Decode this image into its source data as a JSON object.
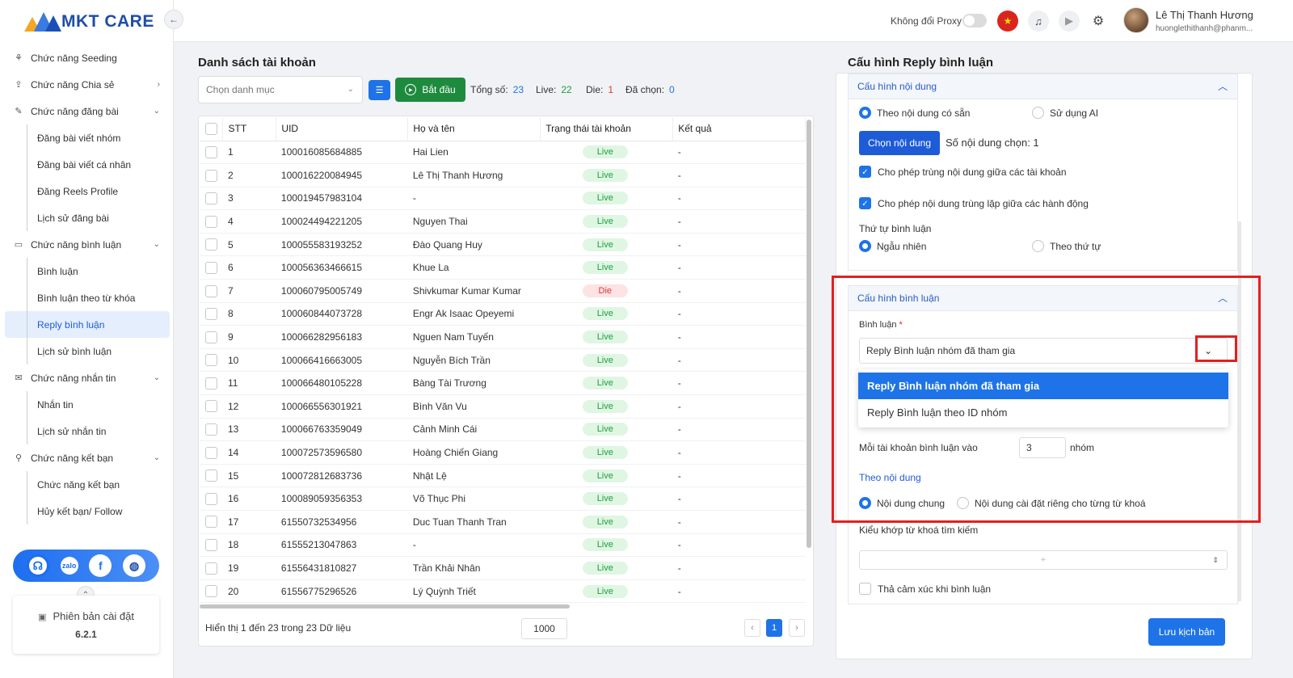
{
  "app": {
    "logo_text": "MKT CARE",
    "brand_color": "#1e4ea8"
  },
  "sidebar": {
    "groups": [
      {
        "label": "Chức năng Seeding",
        "icon": "seeding-icon",
        "chev": ""
      },
      {
        "label": "Chức năng Chia sẻ",
        "icon": "share-icon",
        "chev": "›"
      },
      {
        "label": "Chức năng đăng bài",
        "icon": "post-icon",
        "chev": "⌄"
      }
    ],
    "post_items": [
      "Đăng bài viết nhóm",
      "Đăng bài viết cá nhân",
      "Đăng Reels Profile",
      "Lịch sử đăng bài"
    ],
    "comment_group": "Chức năng bình luận",
    "comment_items": [
      "Bình luận",
      "Bình luận theo từ khóa",
      "Reply bình luận",
      "Lịch sử bình luận"
    ],
    "message_group": "Chức năng nhắn tin",
    "message_items": [
      "Nhắn tin",
      "Lịch sử nhắn tin"
    ],
    "friend_group": "Chức năng kết bạn",
    "friend_items": [
      "Chức năng kết bạn",
      "Hủy kết bạn/ Follow"
    ],
    "version_label": "Phiên bản cài đặt",
    "version_number": "6.2.1"
  },
  "topbar": {
    "proxy_label": "Không đổi Proxy",
    "user_name": "Lê Thị Thanh Hương",
    "user_email": "huonglethithanh@phanm..."
  },
  "accounts": {
    "title": "Danh sách tài khoản",
    "category_placeholder": "Chọn danh mục",
    "start_label": "Bắt đầu",
    "stats": {
      "total_label": "Tổng số:",
      "total": "23",
      "live_label": "Live:",
      "live": "22",
      "die_label": "Die:",
      "die": "1",
      "selected_label": "Đã chọn:",
      "selected": "0"
    },
    "columns": [
      "STT",
      "UID",
      "Họ và tên",
      "Trạng thái tài khoản",
      "Kết quả"
    ],
    "rows": [
      [
        "1",
        "100016085684885",
        "Hai Lien",
        "Live",
        "-"
      ],
      [
        "2",
        "100016220084945",
        "Lê Thị Thanh Hương",
        "Live",
        "-"
      ],
      [
        "3",
        "100019457983104",
        "-",
        "Live",
        "-"
      ],
      [
        "4",
        "100024494221205",
        "Nguyen Thai",
        "Live",
        "-"
      ],
      [
        "5",
        "100055583193252",
        "Đào Quang Huy",
        "Live",
        "-"
      ],
      [
        "6",
        "100056363466615",
        "Khue La",
        "Live",
        "-"
      ],
      [
        "7",
        "100060795005749",
        "Shivkumar Kumar Kumar",
        "Die",
        "-"
      ],
      [
        "8",
        "100060844073728",
        "Engr Ak Isaac Opeyemi",
        "Live",
        "-"
      ],
      [
        "9",
        "100066282956183",
        "Nguen Nam Tuyến",
        "Live",
        "-"
      ],
      [
        "10",
        "100066416663005",
        "Nguyễn Bích Trần",
        "Live",
        "-"
      ],
      [
        "11",
        "100066480105228",
        "Bàng Tài Trương",
        "Live",
        "-"
      ],
      [
        "12",
        "100066556301921",
        "Bình Văn Vu",
        "Live",
        "-"
      ],
      [
        "13",
        "100066763359049",
        "Cảnh Minh Cái",
        "Live",
        "-"
      ],
      [
        "14",
        "100072573596580",
        "Hoàng Chiến Giang",
        "Live",
        "-"
      ],
      [
        "15",
        "100072812683736",
        "Nhật Lệ",
        "Live",
        "-"
      ],
      [
        "16",
        "100089059356353",
        "Võ Thục Phi",
        "Live",
        "-"
      ],
      [
        "17",
        "61550732534956",
        "Duc Tuan Thanh Tran",
        "Live",
        "-"
      ],
      [
        "18",
        "61555213047863",
        "-",
        "Live",
        "-"
      ],
      [
        "19",
        "61556431810827",
        "Trần Khải Nhân",
        "Live",
        "-"
      ],
      [
        "20",
        "61556775296526",
        "Lý Quỳnh Triết",
        "Live",
        "-"
      ]
    ],
    "footer_text": "Hiển thị 1 đến 23 trong 23 Dữ liệu",
    "page_size": "1000",
    "current_page": "1",
    "prev": "‹",
    "next": "›"
  },
  "config": {
    "title": "Cấu hình Reply bình luận",
    "content_section": "Cấu hình nội dung",
    "radio_preset": "Theo nội dung có sẵn",
    "radio_ai": "Sử dụng AI",
    "choose_content": "Chọn nội dung",
    "content_count": "Số nội dung chọn: 1",
    "allow_dup_accounts": "Cho phép trùng nội dung giữa các tài khoản",
    "allow_dup_actions": "Cho phép nội dung trùng lặp giữa các hành động",
    "order_label": "Thứ tự bình luận",
    "order_random": "Ngẫu nhiên",
    "order_seq": "Theo thứ tự",
    "comment_section": "Cấu hình bình luận",
    "comment_label": "Bình luận",
    "required_mark": "*",
    "comment_value": "Reply Bình luận nhóm đã tham gia",
    "options": [
      "Reply Bình luận nhóm đã tham gia",
      "Reply Bình luận theo ID nhóm"
    ],
    "per_account_label": "Mỗi tài khoản bình luận vào",
    "per_account_value": "3",
    "per_account_unit": "nhóm",
    "by_content": "Theo nội dung",
    "content_common": "Nội dung chung",
    "content_per_keyword": "Nội dung cài đặt riêng cho từng từ khoá",
    "keyword_match_label": "Kiểu khớp từ khoá tìm kiếm",
    "keyword_match_value": "+",
    "react_label": "Thả cảm xúc khi bình luận",
    "save_label": "Lưu kịch bản"
  },
  "colors": {
    "primary": "#1e73e8",
    "live": "#1e9e3e",
    "die": "#d63a3a",
    "annotation": "#e41f1f"
  }
}
